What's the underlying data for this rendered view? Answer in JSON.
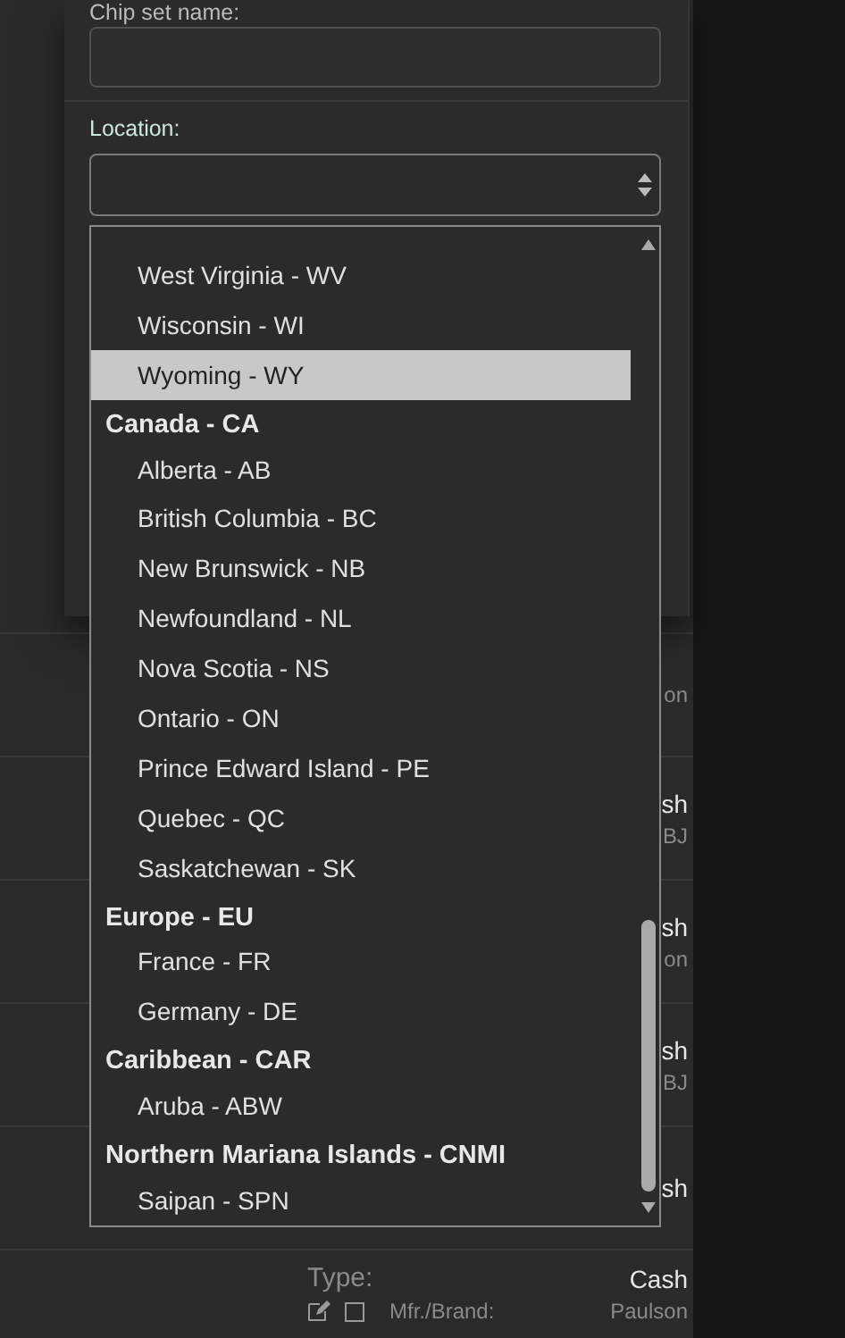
{
  "form": {
    "name_label": "Chip set name:",
    "location_label": "Location:"
  },
  "dropdown": {
    "items": [
      {
        "kind": "option",
        "label": "West Virginia - WV",
        "selected": false
      },
      {
        "kind": "option",
        "label": "Wisconsin - WI",
        "selected": false
      },
      {
        "kind": "option",
        "label": "Wyoming - WY",
        "selected": true
      },
      {
        "kind": "group",
        "label": "Canada - CA"
      },
      {
        "kind": "option",
        "label": "Alberta - AB",
        "selected": false
      },
      {
        "kind": "option",
        "label": "British Columbia - BC",
        "selected": false
      },
      {
        "kind": "option",
        "label": "New Brunswick - NB",
        "selected": false
      },
      {
        "kind": "option",
        "label": "Newfoundland - NL",
        "selected": false
      },
      {
        "kind": "option",
        "label": "Nova Scotia - NS",
        "selected": false
      },
      {
        "kind": "option",
        "label": "Ontario - ON",
        "selected": false
      },
      {
        "kind": "option",
        "label": "Prince Edward Island - PE",
        "selected": false
      },
      {
        "kind": "option",
        "label": "Quebec - QC",
        "selected": false
      },
      {
        "kind": "option",
        "label": "Saskatchewan - SK",
        "selected": false
      },
      {
        "kind": "group",
        "label": "Europe - EU"
      },
      {
        "kind": "option",
        "label": "France - FR",
        "selected": false
      },
      {
        "kind": "option",
        "label": "Germany - DE",
        "selected": false
      },
      {
        "kind": "group",
        "label": "Caribbean - CAR"
      },
      {
        "kind": "option",
        "label": "Aruba - ABW",
        "selected": false
      },
      {
        "kind": "group",
        "label": "Northern Mariana Islands - CNMI"
      },
      {
        "kind": "option",
        "label": "Saipan - SPN",
        "selected": false
      }
    ]
  },
  "rows": [
    {
      "kind": "clipped",
      "brand": "on"
    },
    {
      "kind": "clipped",
      "type": "sh",
      "brand": "BJ"
    },
    {
      "kind": "clipped",
      "type": "sh",
      "brand": "on"
    },
    {
      "kind": "clipped",
      "type": "sh",
      "brand": "BJ"
    },
    {
      "kind": "clipped",
      "type": "sh"
    },
    {
      "kind": "full",
      "checked": false,
      "type_label": "Type:",
      "type": "Cash",
      "brand_label": "Mfr./Brand:",
      "brand": "Paulson"
    }
  ]
}
